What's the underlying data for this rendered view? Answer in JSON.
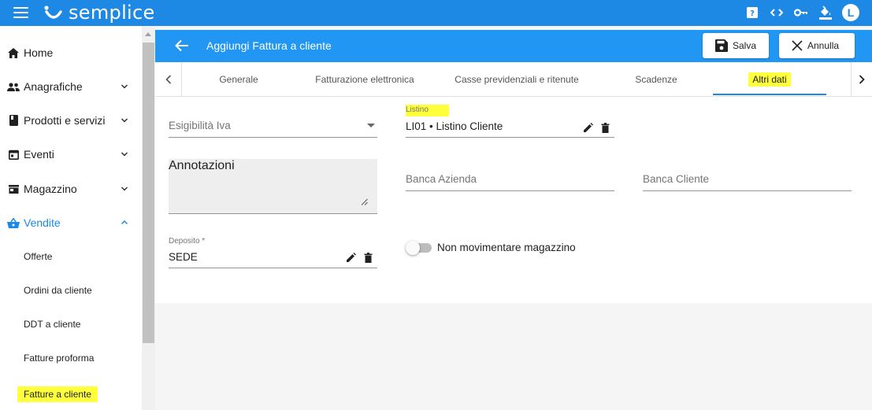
{
  "app": {
    "name": "semplice",
    "avatar_letter": "L"
  },
  "topbar_icons": [
    "help-icon",
    "code-icon",
    "key-icon",
    "paint-bucket-icon"
  ],
  "sidebar": {
    "items": [
      {
        "label": "Home",
        "icon": "home-icon"
      },
      {
        "label": "Anagrafiche",
        "icon": "people-icon"
      },
      {
        "label": "Prodotti e servizi",
        "icon": "book-icon"
      },
      {
        "label": "Eventi",
        "icon": "calendar-icon"
      },
      {
        "label": "Magazzino",
        "icon": "warehouse-icon"
      },
      {
        "label": "Vendite",
        "icon": "basket-icon"
      }
    ],
    "subitems": [
      {
        "label": "Offerte"
      },
      {
        "label": "Ordini da cliente"
      },
      {
        "label": "DDT a cliente"
      },
      {
        "label": "Fatture proforma"
      },
      {
        "label": "Fatture a cliente"
      }
    ]
  },
  "header": {
    "title": "Aggiungi Fattura a cliente",
    "save_label": "Salva",
    "cancel_label": "Annulla"
  },
  "tabs": [
    {
      "label": "Generale"
    },
    {
      "label": "Fatturazione elettronica"
    },
    {
      "label": "Casse previdenziali e ritenute"
    },
    {
      "label": "Scadenze"
    },
    {
      "label": "Altri dati"
    }
  ],
  "form": {
    "esigibilita": {
      "placeholder": "Esigibilità Iva"
    },
    "listino": {
      "label": "Listino",
      "value": "LI01 • Listino Cliente"
    },
    "annotazioni": {
      "placeholder": "Annotazioni"
    },
    "banca_azienda": {
      "placeholder": "Banca Azienda"
    },
    "banca_cliente": {
      "placeholder": "Banca Cliente"
    },
    "deposito": {
      "label": "Deposito *",
      "value": "SEDE"
    },
    "non_movimentare": {
      "label": "Non movimentare magazzino",
      "checked": false
    }
  },
  "colors": {
    "primary": "#1e88e5",
    "header": "#2196f3",
    "highlight": "#ffff3b"
  }
}
